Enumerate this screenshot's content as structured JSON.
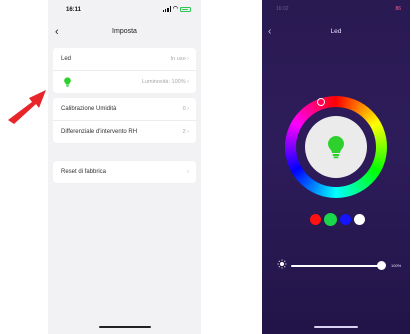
{
  "annotation": {
    "arrow_color": "#e8262a"
  },
  "left": {
    "status": {
      "time": "16:11"
    },
    "header": {
      "back_icon": "chevron-left-icon",
      "title": "Imposta"
    },
    "card1": {
      "led_label": "Led",
      "led_value": "In uso",
      "brightness_value": "Luminosità: 100%",
      "bulb_color": "#2dd02d"
    },
    "card2": {
      "row1": {
        "label": "Calibrazione Umidità",
        "value": "0"
      },
      "row2": {
        "label": "Differenziale d'intervento RH",
        "value": "2"
      }
    },
    "card3": {
      "label": "Reset di fabbrica"
    }
  },
  "right": {
    "status": {
      "time": "16:02",
      "battery": "86"
    },
    "header": {
      "back_icon": "chevron-left-icon",
      "title": "Led"
    },
    "current_color": "#2dd02d",
    "swatches": [
      {
        "name": "red",
        "color": "#ff1111",
        "selected": false
      },
      {
        "name": "green",
        "color": "#19d64a",
        "selected": true
      },
      {
        "name": "blue",
        "color": "#1414ff",
        "selected": false
      },
      {
        "name": "white",
        "color": "#ffffff",
        "selected": false
      }
    ],
    "brightness": {
      "value_label": "100%",
      "value": 1.0
    }
  }
}
